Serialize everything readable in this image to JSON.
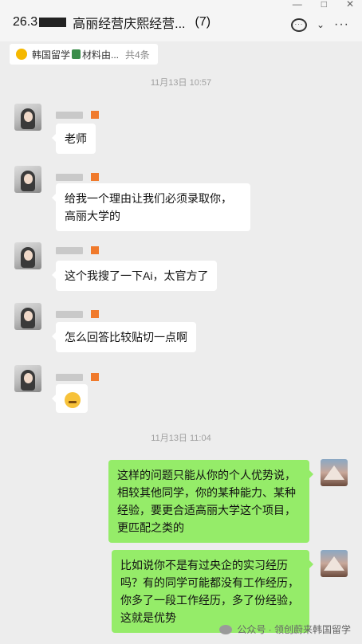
{
  "header": {
    "title_prefix": "26.3",
    "title_main": "高丽经营庆熙经营...",
    "member_count": "(7)",
    "window_min": "—",
    "window_max": "□",
    "window_close": "✕",
    "chat_icon": "chat-bubble-icon",
    "chat_icon_glyph": "···",
    "chevron_glyph": "⌄",
    "more_glyph": "···"
  },
  "pinned": {
    "label_a": "韩国留学",
    "label_b": "材料由...",
    "total": "共4条"
  },
  "timestamps": [
    "11月13日 10:57",
    "11月13日 11:04"
  ],
  "messages": [
    {
      "side": "left",
      "text": "老师"
    },
    {
      "side": "left",
      "text": "给我一个理由让我们必须录取你，高丽大学的"
    },
    {
      "side": "left",
      "text": "这个我搜了一下Ai，太官方了"
    },
    {
      "side": "left",
      "text": "怎么回答比较贴切一点啊"
    },
    {
      "side": "left",
      "text": "",
      "emoji": "grimace-emoji"
    },
    {
      "side": "right",
      "text": "这样的问题只能从你的个人优势说，相较其他同学，你的某种能力、某种经验，要更合适高丽大学这个项目，更匹配之类的"
    },
    {
      "side": "right",
      "text": "比如说你不是有过央企的实习经历吗？有的同学可能都没有工作经历，你多了一段工作经历，多了份经验，这就是优势"
    }
  ],
  "watermark": "公众号 · 领创蔚来韩国留学",
  "colors": {
    "incoming_bubble": "#ffffff",
    "outgoing_bubble": "#95ec69",
    "background": "#ededed"
  }
}
